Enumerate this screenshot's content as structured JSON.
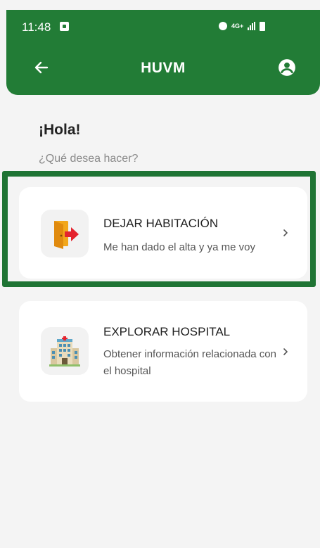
{
  "status_bar": {
    "time": "11:48",
    "network": "4G+"
  },
  "header": {
    "title": "HUVM",
    "back_icon": "arrow-left-icon",
    "account_icon": "account-circle-icon"
  },
  "greeting": {
    "title": "¡Hola!",
    "subtitle": "¿Qué desea hacer?"
  },
  "options": [
    {
      "title": "DEJAR HABITACIÓN",
      "description": "Me han dado el alta y ya me voy",
      "icon": "exit-door-icon",
      "highlighted": true
    },
    {
      "title": "EXPLORAR HOSPITAL",
      "description": "Obtener información relacionada con el hospital",
      "icon": "hospital-building-icon",
      "highlighted": false
    }
  ],
  "colors": {
    "primary": "#227c36",
    "highlight_border": "#1f7434",
    "background": "#f4f4f4",
    "card": "#ffffff"
  }
}
